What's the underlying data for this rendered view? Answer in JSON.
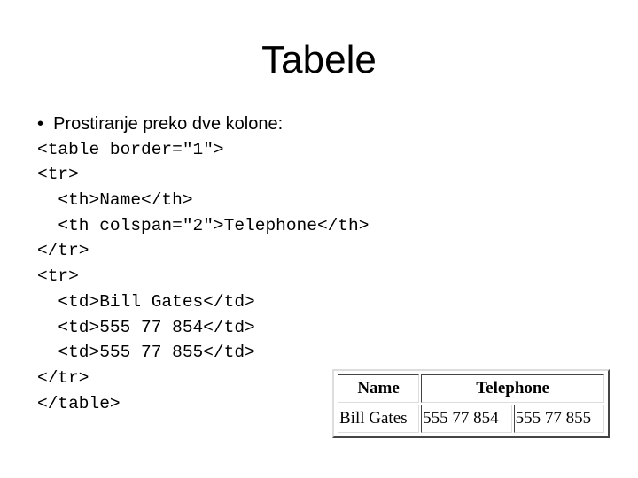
{
  "slide": {
    "title": "Tabele",
    "bullet": "Prostiranje preko dve kolone:",
    "code_lines": [
      "<table border=\"1\">",
      "<tr>",
      "  <th>Name</th>",
      "  <th colspan=\"2\">Telephone</th>",
      "</tr>",
      "<tr>",
      "  <td>Bill Gates</td>",
      "  <td>555 77 854</td>",
      "  <td>555 77 855</td>",
      "</tr>",
      "</table>"
    ],
    "rendered_table": {
      "headers": [
        "Name",
        "Telephone"
      ],
      "rows": [
        [
          "Bill Gates",
          "555 77 854",
          "555 77 855"
        ]
      ]
    }
  }
}
